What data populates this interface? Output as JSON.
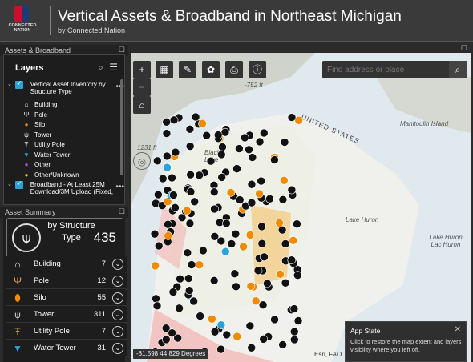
{
  "header": {
    "logo_text": "CONNECTED NATION",
    "title": "Vertical Assets & Broadband in Northeast Michigan",
    "subtitle": "by Connected Nation"
  },
  "layers_panel": {
    "section_title": "Assets & Broadband",
    "heading": "Layers",
    "group1_label": "Vertical Asset Inventory by Structure Type",
    "legend": [
      {
        "label": "Building",
        "icon": "building-icon"
      },
      {
        "label": "Pole",
        "icon": "pole-icon"
      },
      {
        "label": "Silo",
        "icon": "silo-icon"
      },
      {
        "label": "Tower",
        "icon": "tower-icon"
      },
      {
        "label": "Utility Pole",
        "icon": "utility-pole-icon"
      },
      {
        "label": "Water Tower",
        "icon": "water-tower-icon"
      },
      {
        "label": "Other",
        "icon": "purple-dot-icon"
      },
      {
        "label": "Other/Unknown",
        "icon": "yellow-dot-icon"
      }
    ],
    "group2_label": "Broadband - At Least 25M Download/3M Upload (Fixed,"
  },
  "summary": {
    "section_title": "Asset Summary",
    "big_label": "by Structure Type",
    "big_value": "435",
    "rows": [
      {
        "label": "Building",
        "value": "7",
        "icon": "building-icon"
      },
      {
        "label": "Pole",
        "value": "12",
        "icon": "pole-icon"
      },
      {
        "label": "Silo",
        "value": "55",
        "icon": "silo-icon"
      },
      {
        "label": "Tower",
        "value": "311",
        "icon": "tower-icon"
      },
      {
        "label": "Utility Pole",
        "value": "7",
        "icon": "utility-pole-icon"
      },
      {
        "label": "Water Tower",
        "value": "31",
        "icon": "water-tower-icon"
      }
    ]
  },
  "map": {
    "search_placeholder": "Find address or place",
    "labels": {
      "united_states": "UNITED STATES",
      "lake_huron": "Lake Huron",
      "lake_huron2": "Lake Huron Lac Huron",
      "manitoulin": "Manitoulin Island",
      "elev1": "-752 ft",
      "elev2": "1231 ft",
      "black_lake": "Black Lake"
    },
    "coords": "-81.598 44.829 Degrees",
    "attribution": "Esri, FAO"
  },
  "app_state": {
    "title": "App State",
    "description": "Click to restore the map extent and layers visibility where you left off."
  },
  "colors": {
    "accent": "#29a3d8",
    "panel": "#1d1d1d",
    "header": "#3a3a3a",
    "lake": "#dfe9ee"
  }
}
